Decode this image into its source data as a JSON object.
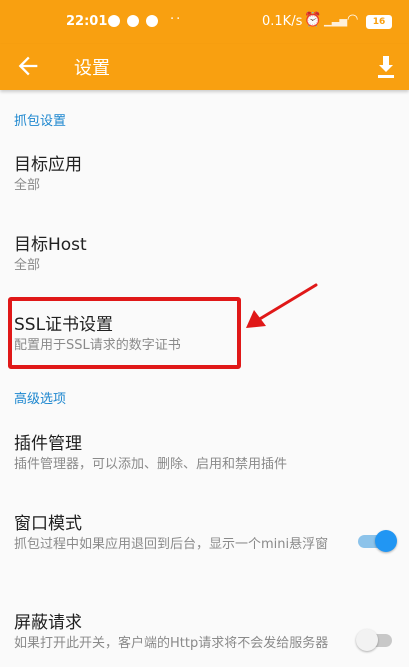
{
  "status_bar": {
    "time": "22:01",
    "dots": "··",
    "net_speed": "0.1K/s",
    "battery": "16"
  },
  "toolbar": {
    "title": "设置",
    "back_icon": "arrow-left-icon",
    "download_icon": "download-icon"
  },
  "sections": {
    "capture": "抓包设置",
    "advanced": "高级选项"
  },
  "items": {
    "target_app": {
      "title": "目标应用",
      "summary": "全部"
    },
    "target_host": {
      "title": "目标Host",
      "summary": "全部"
    },
    "ssl_cert": {
      "title": "SSL证书设置",
      "summary": "配置用于SSL请求的数字证书"
    },
    "plugin_mgmt": {
      "title": "插件管理",
      "summary": "插件管理器，可以添加、删除、启用和禁用插件"
    },
    "window_mode": {
      "title": "窗口模式",
      "summary": "抓包过程中如果应用退回到后台，显示一个mini悬浮窗",
      "enabled": true
    },
    "block_request": {
      "title": "屏蔽请求",
      "summary": "如果打开此开关，客户端的Http请求将不会发给服务器",
      "enabled": false
    }
  },
  "colors": {
    "accent": "#f9a010",
    "section_text": "#1d87cf",
    "toggle_on": "#2196f3",
    "annotation": "#e01818"
  }
}
